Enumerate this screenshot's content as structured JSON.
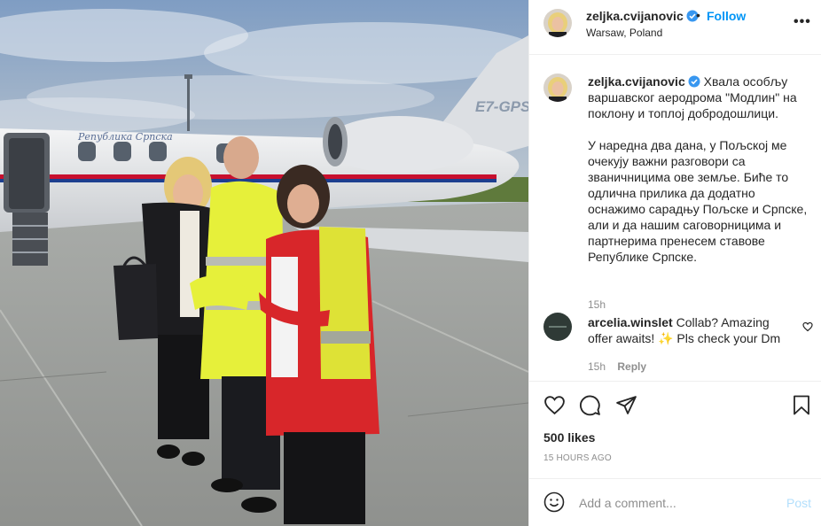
{
  "post": {
    "photo_alt": "Three people posing in front of a private jet on an airport apron",
    "aircraft_registration": "E7-GPS",
    "aircraft_livery_text": "Република Српска"
  },
  "header": {
    "username": "zeljka.cvijanovic",
    "dot": "•",
    "follow_label": "Follow",
    "location": "Warsaw, Poland",
    "more_label": "•••"
  },
  "caption": {
    "username": "zeljka.cvijanovic",
    "paragraph_1": "Хвала особљу варшавског аеродрома \"Модлин\" на поклону и топлој добродошлици.",
    "paragraph_2": "У наредна два дана, у Пољској ме очекују важни разговори са званичницима ове земље. Биће то одлична прилика да додатно оснажимо сарадњу Пољске и Српске, али и да нашим саговорницима и партнерима пренесем ставове Републике Српске.",
    "time": "15h"
  },
  "comment": {
    "username": "arcelia.winslet",
    "text": "Collab? Amazing offer awaits! ✨ Pls check your Dm",
    "time": "15h",
    "reply_label": "Reply"
  },
  "actions": {
    "likes": "500 likes",
    "time_ago": "15 HOURS AGO"
  },
  "add_comment": {
    "placeholder": "Add a comment...",
    "post_label": "Post"
  },
  "colors": {
    "accent": "#0095f6",
    "verified": "#3897f0",
    "text": "#262626",
    "muted": "#8e8e8e",
    "post_disabled": "#b2dffc",
    "divider": "#efefef"
  }
}
